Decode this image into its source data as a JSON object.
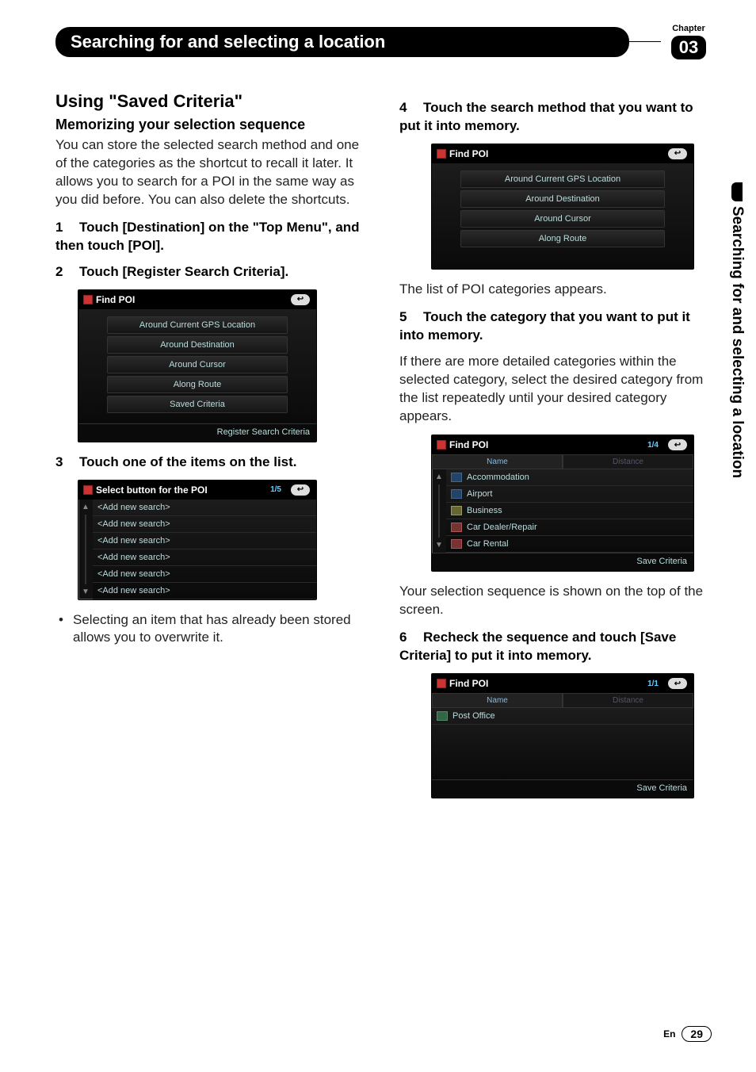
{
  "header": {
    "title": "Searching for and selecting a location",
    "chapter_label": "Chapter",
    "chapter_num": "03"
  },
  "side_tab": "Searching for and selecting a location",
  "left": {
    "h2_a": "Using ",
    "h2_b": "\"Saved Criteria\"",
    "h3": "Memorizing your selection sequence",
    "intro": "You can store the selected search method and one of the categories as the shortcut to recall it later. It allows you to search for a POI in the same way as you did before. You can also delete the shortcuts.",
    "step1": "Touch [Destination] on the \"Top Menu\", and then touch [POI].",
    "step2": "Touch [Register Search Criteria].",
    "step3": "Touch one of the items on the list.",
    "note": "Selecting an item that has already been stored allows you to overwrite it."
  },
  "right": {
    "step4": "Touch the search method that you want to put it into memory.",
    "after4": "The list of POI categories appears.",
    "step5": "Touch the category that you want to put it into memory.",
    "after5": "If there are more detailed categories within the selected category, select the desired category from the list repeatedly until your desired category appears.",
    "after_list": "Your selection sequence is shown on the top of the screen.",
    "step6": "Recheck the sequence and touch [Save Criteria] to put it into memory."
  },
  "shots": {
    "findpoi_title": "Find POI",
    "back_icon": "↩",
    "s1_items": [
      "Around Current GPS Location",
      "Around Destination",
      "Around Cursor",
      "Along Route",
      "Saved Criteria"
    ],
    "s1_foot": "Register Search Criteria",
    "s2_title": "Select button for the POI",
    "s2_page": "1/5",
    "s2_item": "<Add new search>",
    "s3_items": [
      "Around Current GPS Location",
      "Around Destination",
      "Around Cursor",
      "Along Route"
    ],
    "s4_page": "1/4",
    "s4_tabs": {
      "name": "Name",
      "dist": "Distance"
    },
    "s4_items": [
      "Accommodation",
      "Airport",
      "Business",
      "Car Dealer/Repair",
      "Car Rental"
    ],
    "s4_foot": "Save Criteria",
    "s5_page": "1/1",
    "s5_item": "Post Office",
    "s5_foot": "Save Criteria"
  },
  "footer": {
    "lang": "En",
    "page": "29"
  }
}
